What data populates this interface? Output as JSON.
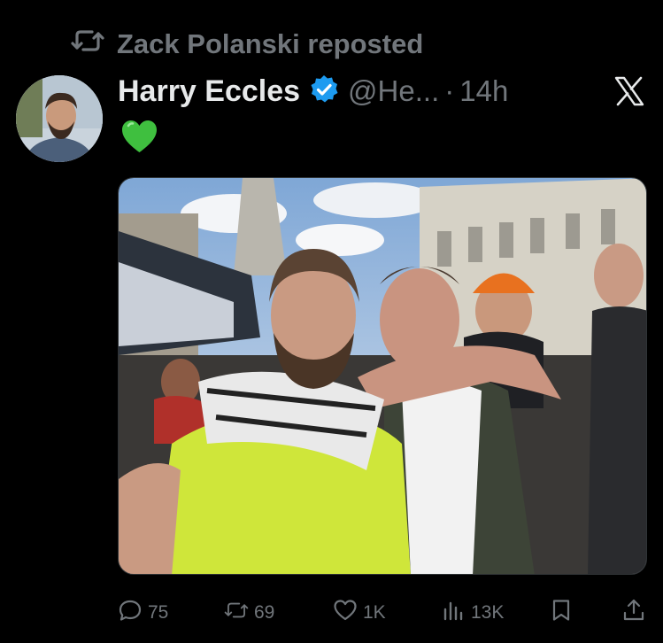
{
  "repost": {
    "text": "Zack Polanski reposted",
    "icon": "repost-icon"
  },
  "tweet": {
    "author_name": "Harry Eccles",
    "verified": true,
    "handle": "@He...",
    "separator": "·",
    "time": "14h",
    "text_emoji": "green-heart-emoji"
  },
  "actions": {
    "replies": "75",
    "reposts": "69",
    "likes": "1K",
    "views": "13K"
  },
  "colors": {
    "background": "#000000",
    "primary_text": "#e7e9ea",
    "secondary_text": "#71767b",
    "verified_blue": "#1d9bf0",
    "heart_green": "#3fbf3f"
  }
}
